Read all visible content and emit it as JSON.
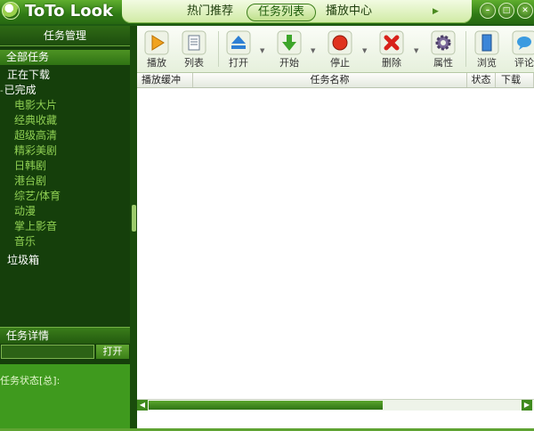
{
  "app": {
    "logo_text": "ToTo Look"
  },
  "nav": {
    "items": [
      "热门推荐",
      "任务列表",
      "播放中心"
    ],
    "active": "任务列表"
  },
  "sidebar": {
    "header": "任务管理",
    "all_tasks": "全部任务",
    "downloading": "正在下载",
    "completed_toggle": "-",
    "completed": "已完成",
    "categories": [
      "电影大片",
      "经典收藏",
      "超级高清",
      "精彩美剧",
      "日韩剧",
      "港台剧",
      "综艺/体育",
      "动漫",
      "掌上影音",
      "音乐"
    ],
    "trash": "垃圾箱"
  },
  "detail": {
    "header": "任务详情",
    "open_button": "打开",
    "status_label": "任务状态[总]:"
  },
  "toolbar": {
    "buttons": [
      "播放",
      "列表",
      "打开",
      "开始",
      "停止",
      "删除",
      "属性",
      "浏览",
      "评论"
    ]
  },
  "table": {
    "columns": [
      "播放缓冲",
      "任务名称",
      "状态",
      "下载"
    ]
  },
  "colors": {
    "brand_green": "#2f7a15",
    "dark_sidebar": "#153f0b",
    "accent_light": "#8fcf53"
  }
}
